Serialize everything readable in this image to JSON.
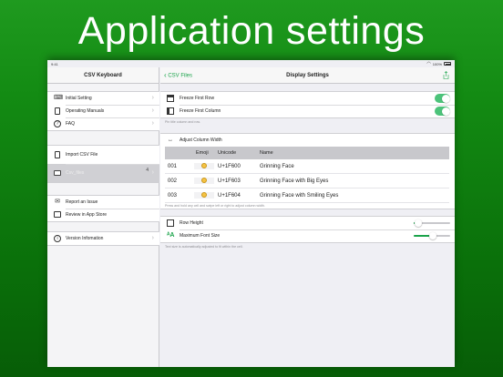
{
  "headline": "Application settings",
  "statusbar": {
    "time": "9:41",
    "battery": "100%"
  },
  "sidebar": {
    "title": "CSV Keyboard",
    "group1": [
      {
        "label": "Initial Setting",
        "icon": "keyboard-icon"
      },
      {
        "label": "Operating Manuals",
        "icon": "book-icon"
      },
      {
        "label": "FAQ",
        "icon": "question-icon"
      }
    ],
    "group2": [
      {
        "label": "Import CSV File",
        "icon": "import-file-icon"
      },
      {
        "label": "Csv_files",
        "count": "4",
        "icon": "folder-icon",
        "selected": true
      }
    ],
    "group3": [
      {
        "label": "Report an Issue",
        "icon": "mail-icon"
      },
      {
        "label": "Review in App Store",
        "icon": "review-icon"
      }
    ],
    "group4": [
      {
        "label": "Version Infomation",
        "icon": "info-icon"
      }
    ]
  },
  "main": {
    "back_label": "CSV Files",
    "title": "Display Settings",
    "freeze_row_label": "Freeze First Row",
    "freeze_row_on": true,
    "freeze_col_label": "Freeze First Column",
    "freeze_col_on": true,
    "freeze_note": "Pin title column and row.",
    "adjust_width_label": "Adjust Column Width",
    "table_headers": [
      "",
      "Emoji",
      "Unicode",
      "Name"
    ],
    "table_rows": [
      {
        "id": "001",
        "unicode": "U+1F600",
        "name": "Grinning Face"
      },
      {
        "id": "002",
        "unicode": "U+1F603",
        "name": "Grinning Face with Big Eyes"
      },
      {
        "id": "003",
        "unicode": "U+1F604",
        "name": "Grinning Face with Smiling Eyes"
      }
    ],
    "table_note": "Press and hold any cell and swipe left or right to adjust column width.",
    "row_height_label": "Row Height",
    "row_height_value": 0.12,
    "max_font_label": "Maximum Font Size",
    "max_font_value": 0.52,
    "font_note": "Text size is automatically adjusted to fit within the cell."
  },
  "colors": {
    "accent": "#1aa34a",
    "toggle_on": "#4cc37a",
    "background": "#138b13"
  }
}
